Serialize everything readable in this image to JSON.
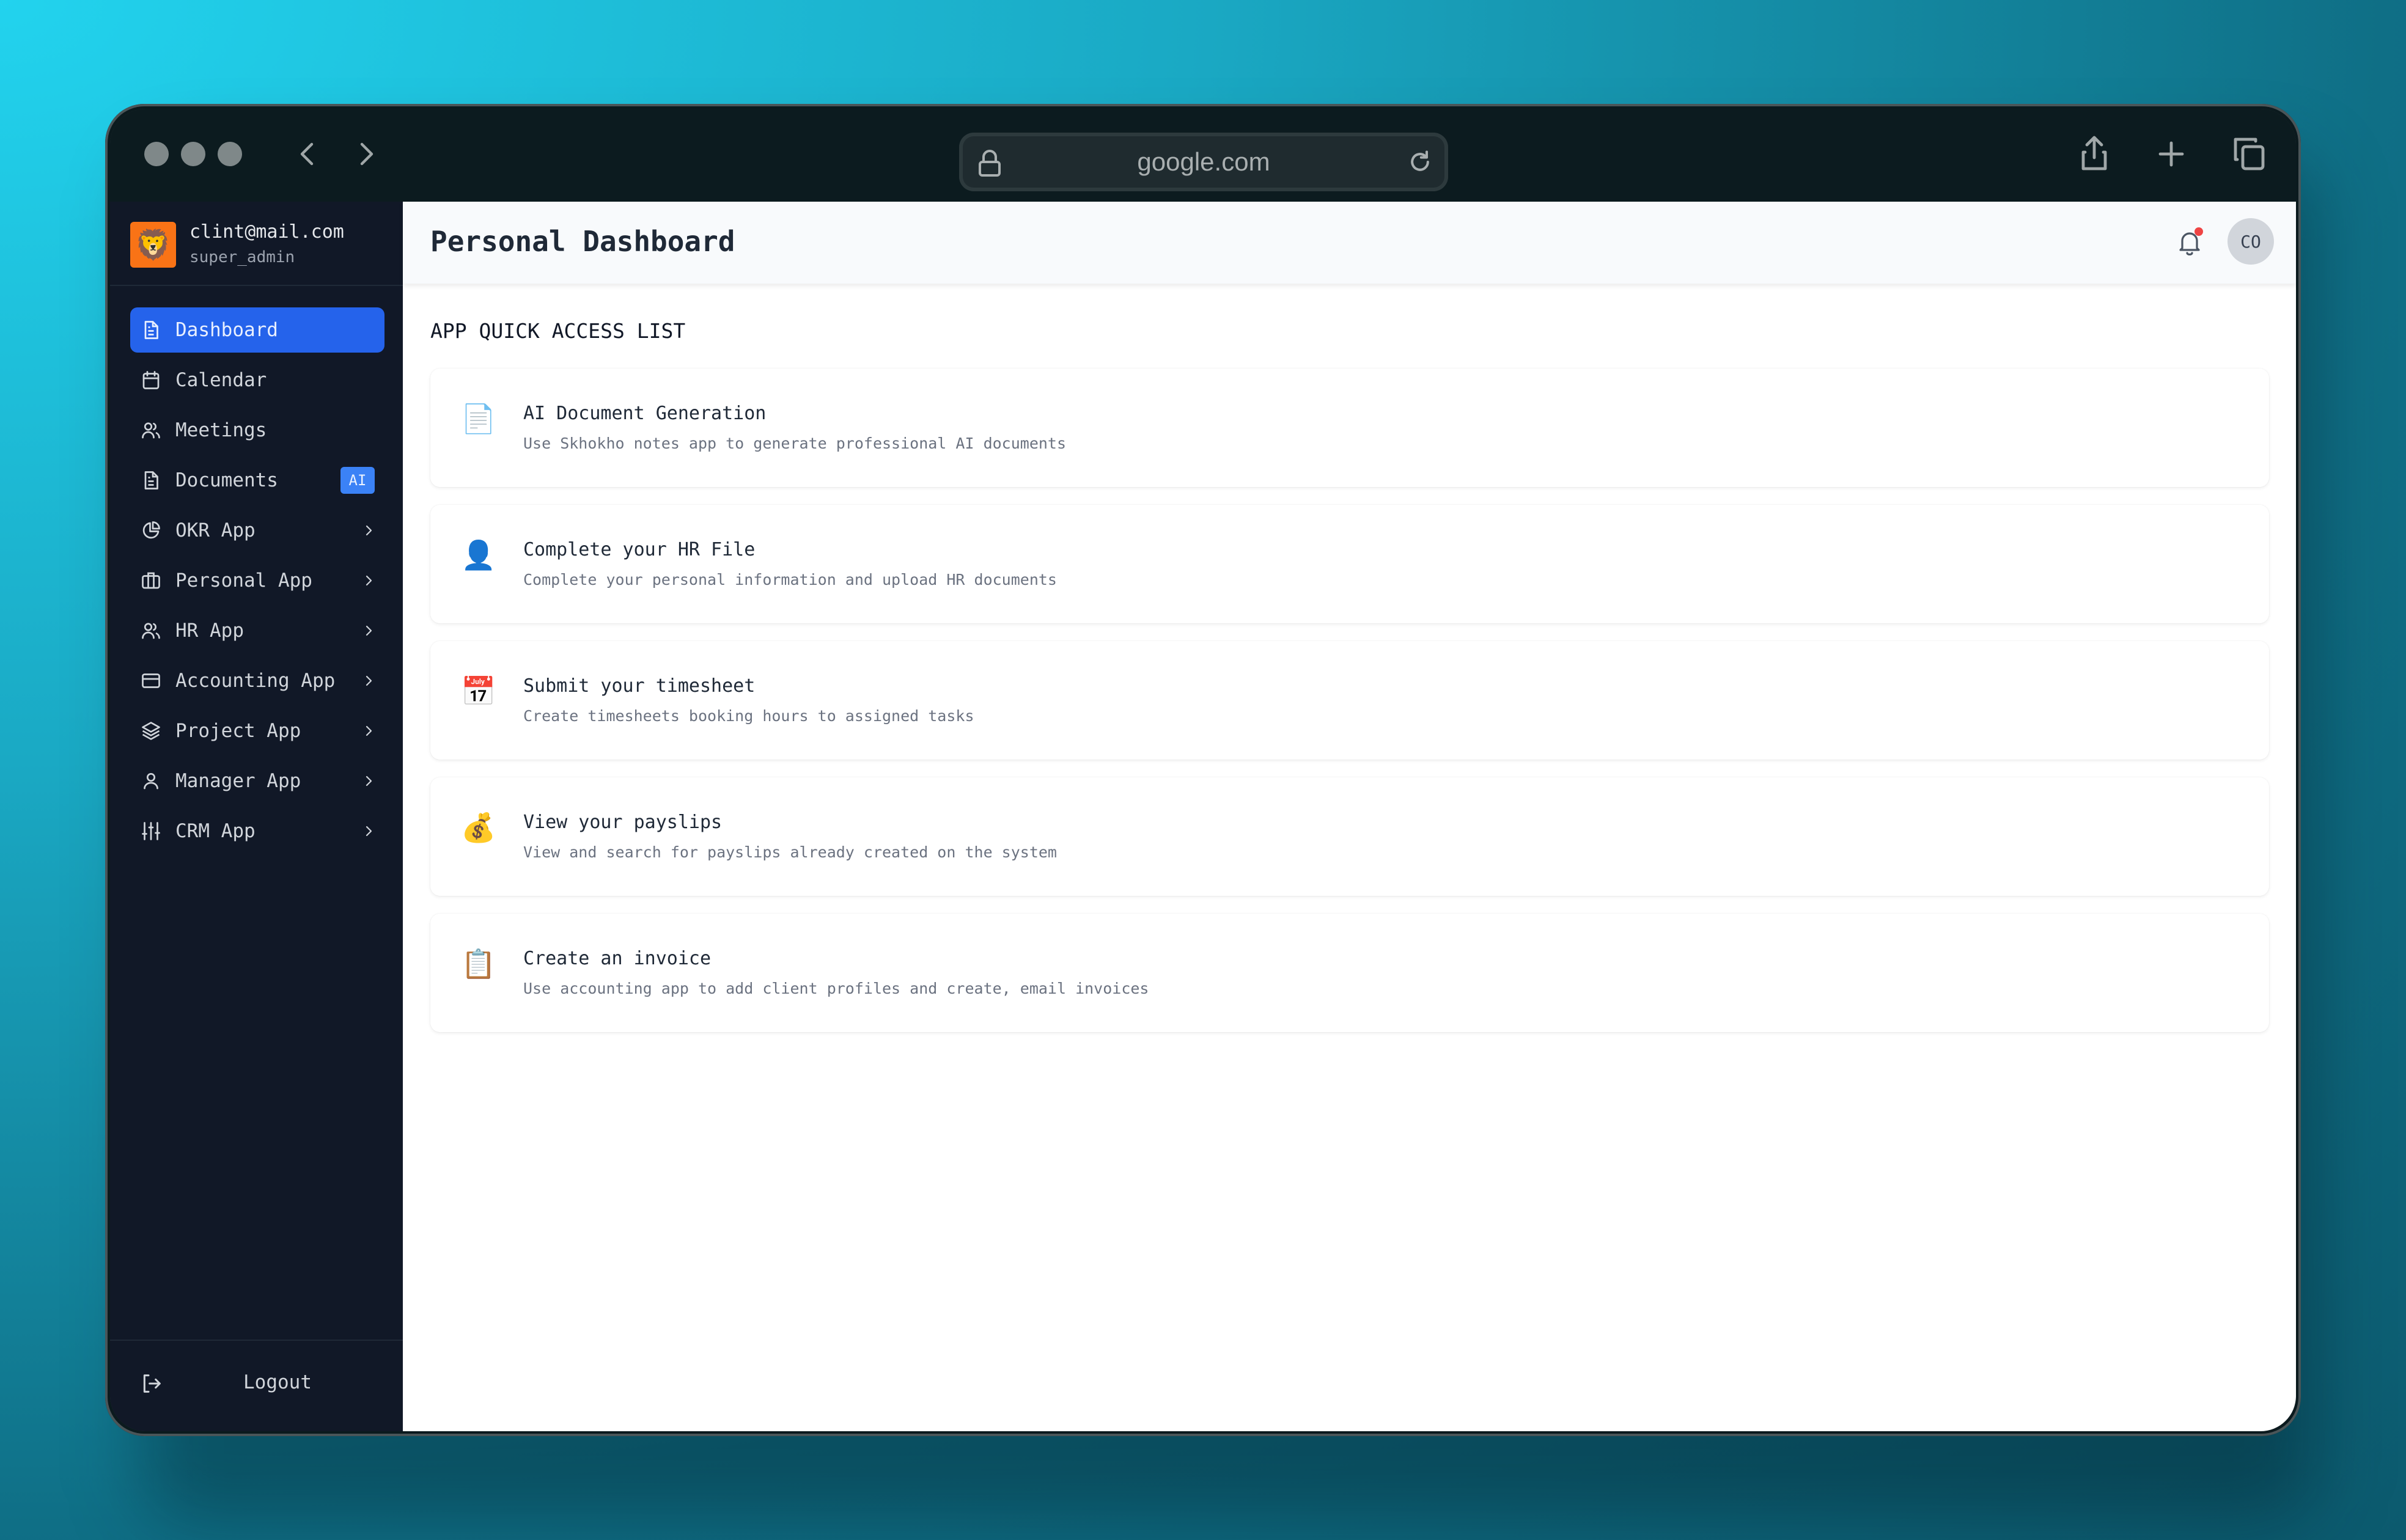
{
  "browser": {
    "url": "google.com",
    "icons": [
      "back-icon",
      "forward-icon",
      "lock-icon",
      "reload-icon",
      "share-icon",
      "new-tab-icon",
      "tabs-icon"
    ]
  },
  "sidebar": {
    "user": {
      "email": "clint@mail.com",
      "role": "super_admin",
      "avatar_icon": "lion-face"
    },
    "items": [
      {
        "label": "Dashboard",
        "icon": "document-icon",
        "active": true
      },
      {
        "label": "Calendar",
        "icon": "calendar-icon"
      },
      {
        "label": "Meetings",
        "icon": "users-icon"
      },
      {
        "label": "Documents",
        "icon": "document-icon",
        "badge": "AI"
      },
      {
        "label": "OKR App",
        "icon": "pie-chart-icon",
        "expandable": true
      },
      {
        "label": "Personal App",
        "icon": "briefcase-icon",
        "expandable": true
      },
      {
        "label": "HR App",
        "icon": "users-icon",
        "expandable": true
      },
      {
        "label": "Accounting App",
        "icon": "credit-card-icon",
        "expandable": true
      },
      {
        "label": "Project App",
        "icon": "layers-icon",
        "expandable": true
      },
      {
        "label": "Manager App",
        "icon": "user-icon",
        "expandable": true
      },
      {
        "label": "CRM App",
        "icon": "sliders-icon",
        "expandable": true
      }
    ],
    "logout_label": "Logout"
  },
  "header": {
    "title": "Personal Dashboard",
    "user_initials": "CO",
    "has_notification": true
  },
  "main": {
    "section_title": "APP QUICK ACCESS LIST",
    "cards": [
      {
        "icon": "📄",
        "icon_name": "page-icon",
        "title": "AI Document Generation",
        "description": "Use Skhokho notes app to generate professional AI documents"
      },
      {
        "icon": "👤",
        "icon_name": "person-silhouette-icon",
        "title": "Complete your HR File",
        "description": "Complete your personal information and upload HR documents"
      },
      {
        "icon": "📅",
        "icon_name": "calendar-icon",
        "title": "Submit your timesheet",
        "description": "Create timesheets booking hours to assigned tasks"
      },
      {
        "icon": "💰",
        "icon_name": "money-bag-icon",
        "title": "View your payslips",
        "description": "View and search for payslips already created on the system"
      },
      {
        "icon": "📋",
        "icon_name": "clipboard-icon",
        "title": "Create an invoice",
        "description": "Use accounting app to add client profiles and create, email invoices"
      }
    ]
  },
  "colors": {
    "accent": "#2563eb",
    "sidebar_bg": "#111827",
    "badge": "#3b82f6",
    "avatar_bg": "#f97316",
    "notification_dot": "#ef4444"
  }
}
